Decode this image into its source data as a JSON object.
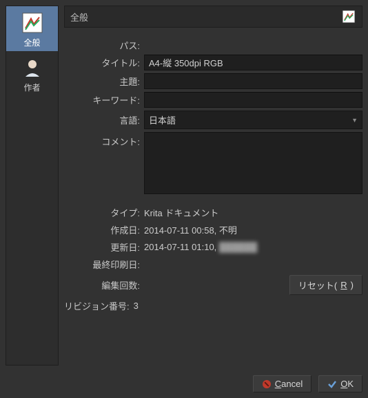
{
  "sidebar": {
    "items": [
      {
        "label": "全般"
      },
      {
        "label": "作者"
      }
    ]
  },
  "header": {
    "title": "全般"
  },
  "form": {
    "labels": {
      "path": "パス:",
      "title": "タイトル:",
      "subject": "主題:",
      "keywords": "キーワード:",
      "language": "言語:",
      "comment": "コメント:"
    },
    "values": {
      "path": "",
      "title": "A4-縦 350dpi RGB",
      "subject": "",
      "keywords": "",
      "language": "日本語",
      "comment": ""
    }
  },
  "info": {
    "labels": {
      "type": "タイプ:",
      "created": "作成日:",
      "modified": "更新日:",
      "printed": "最終印刷日:",
      "edits": "編集回数:",
      "revision": "リビジョン番号:"
    },
    "values": {
      "type": "Krita ドキュメント",
      "created": "2014-07-11 00:58, 不明",
      "modified_time": "2014-07-11 01:10, ",
      "modified_by": "██████",
      "printed": "",
      "edits": "",
      "revision": "3"
    }
  },
  "buttons": {
    "reset_prefix": "リセット(",
    "reset_key": "R",
    "reset_suffix": ")",
    "cancel_key": "C",
    "cancel_rest": "ancel",
    "ok_key": "O",
    "ok_rest": "K"
  }
}
